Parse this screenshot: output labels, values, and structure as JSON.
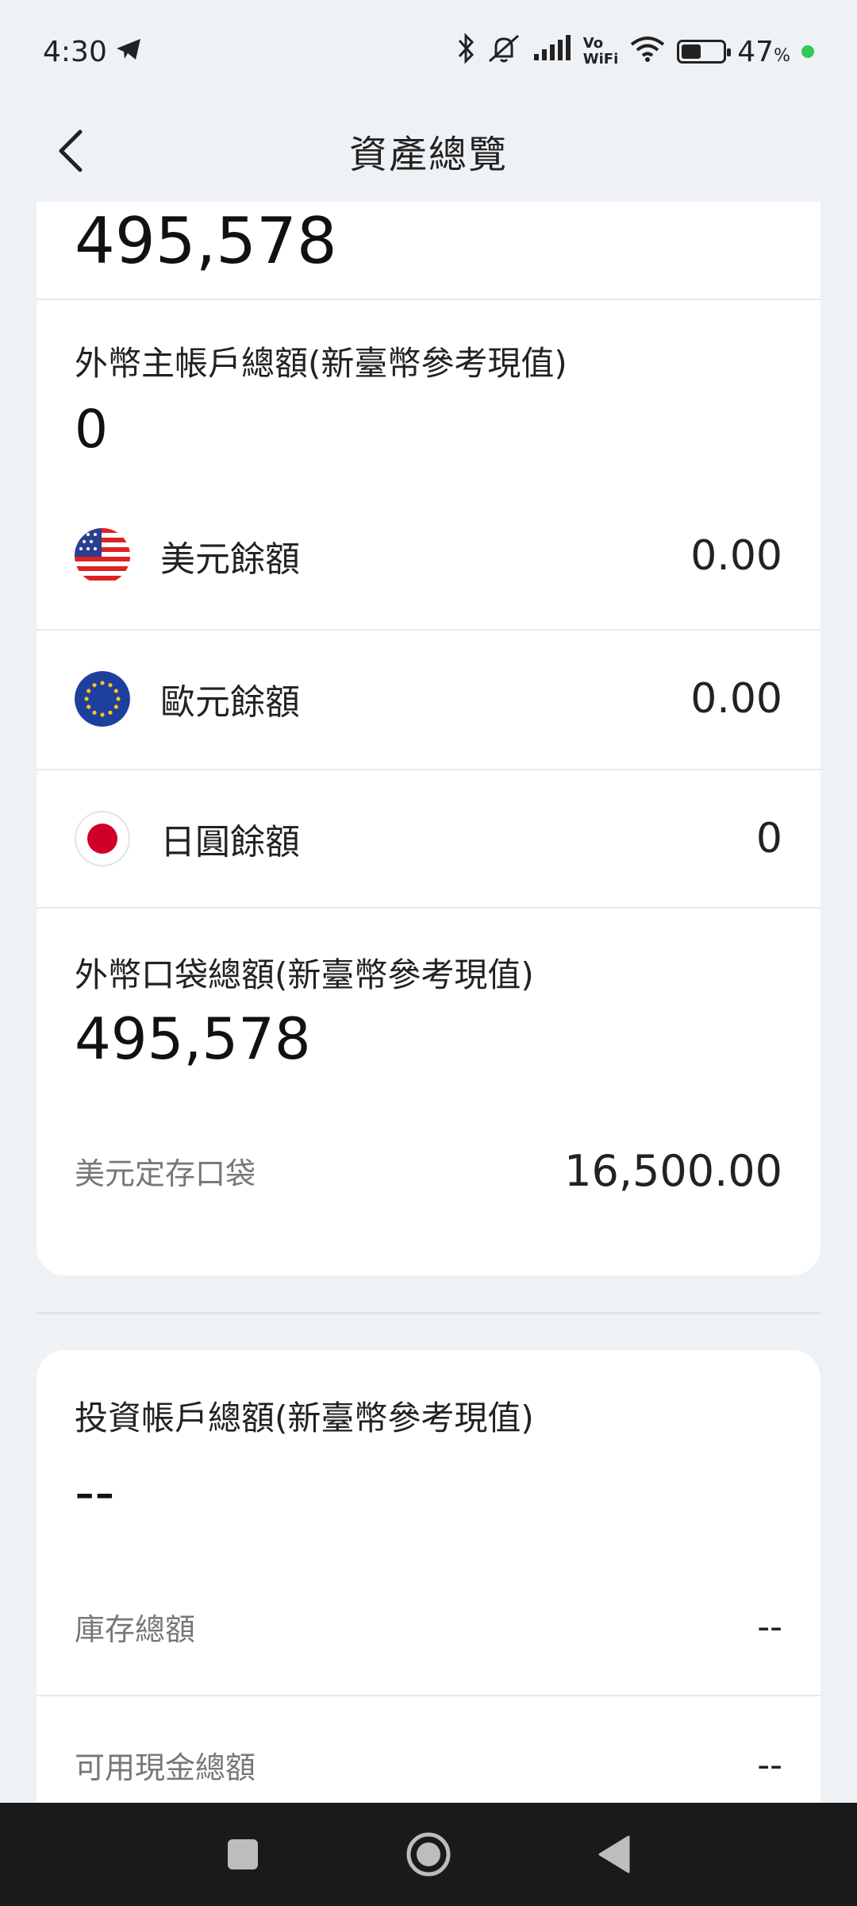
{
  "status": {
    "time": "4:30",
    "battery_pct": "47",
    "pct_sign": "%",
    "battery_level": 0.47,
    "vo_label": "Vo",
    "wifi_label": "WiFi"
  },
  "header": {
    "title": "資產總覽"
  },
  "main": {
    "top_total": "495,578",
    "fx_main": {
      "label": "外幣主帳戶總額(新臺幣參考現值)",
      "total": "0",
      "currencies": [
        {
          "name": "美元餘額",
          "value": "0.00",
          "icon": "us-flag-icon"
        },
        {
          "name": "歐元餘額",
          "value": "0.00",
          "icon": "eu-flag-icon"
        },
        {
          "name": "日圓餘額",
          "value": "0",
          "icon": "jp-flag-icon"
        }
      ]
    },
    "fx_pocket": {
      "label": "外幣口袋總額(新臺幣參考現值)",
      "total": "495,578",
      "items": [
        {
          "label": "美元定存口袋",
          "value": "16,500.00"
        }
      ]
    }
  },
  "invest": {
    "label": "投資帳戶總額(新臺幣參考現值)",
    "total": "--",
    "items": [
      {
        "label": "庫存總額",
        "value": "--"
      },
      {
        "label": "可用現金總額",
        "value": "--"
      }
    ]
  },
  "colors": {
    "background": "#eff2f5",
    "card": "#ffffff",
    "nav_bar": "#1a1a1a",
    "battery_dot": "#34c759"
  }
}
